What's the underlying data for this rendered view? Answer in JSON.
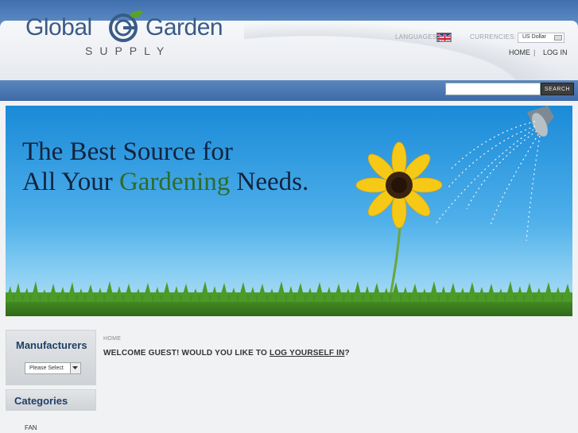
{
  "brand": {
    "word1": "Global",
    "word2": "Garden",
    "tagline": "SUPPLY",
    "colors": {
      "primary": "#3a5b86",
      "accent_green": "#5aa02c"
    }
  },
  "header": {
    "languages_label": "LANGUAGES:",
    "language_flag_icon": "uk-flag-icon",
    "currencies_label": "CURRENCIES:",
    "currency_value": "US Dollar",
    "links": [
      "HOME",
      "|",
      "LOG IN"
    ]
  },
  "search": {
    "placeholder": "",
    "button_label": "SEARCH"
  },
  "banner": {
    "line1": "The Best Source for",
    "line2_prefix": "All Your ",
    "line2_highlight": "Gardening",
    "line2_suffix": " Needs."
  },
  "sidebar": {
    "manufacturers": {
      "heading": "Manufacturers",
      "select_value": "Please Select"
    },
    "categories": {
      "heading": "Categories",
      "items": [
        "FAN"
      ]
    }
  },
  "main": {
    "breadcrumb": "HOME",
    "welcome_prefix": "WELCOME GUEST! WOULD YOU LIKE TO ",
    "welcome_link": "LOG YOURSELF IN",
    "welcome_suffix": "?"
  }
}
